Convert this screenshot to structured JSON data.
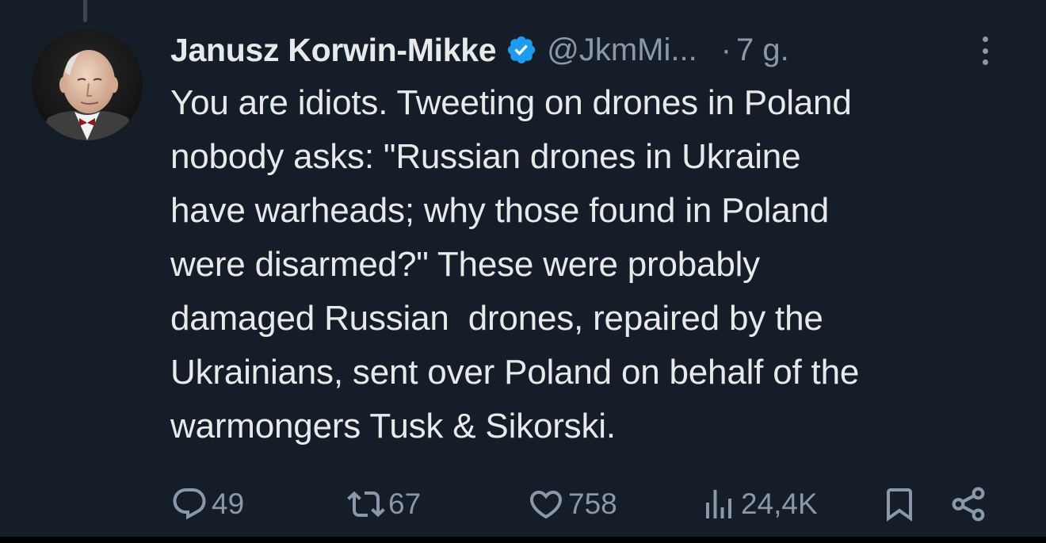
{
  "author": {
    "display_name": "Janusz Korwin-Mikke",
    "handle": "@JkmMi...",
    "verified": true,
    "separator": "·",
    "timestamp": "7 g."
  },
  "tweet": {
    "text": "You are idiots. Tweeting on drones in Poland\nnobody asks: \"Russian drones in Ukraine\nhave warheads; why those found in Poland\nwere disarmed?\" These were probably\ndamaged Russian  drones, repaired by the\nUkrainians, sent over Poland on behalf of the\nwarmongers Tusk & Sikorski."
  },
  "actions": {
    "replies": "49",
    "retweets": "67",
    "likes": "758",
    "views": "24,4K"
  },
  "icons": {
    "reply": "reply-icon",
    "retweet": "retweet-icon",
    "like": "heart-icon",
    "views": "views-icon",
    "bookmark": "bookmark-icon",
    "share": "share-icon",
    "more": "more-options-icon",
    "verified": "verified-badge-icon"
  },
  "colors": {
    "background": "#151d28",
    "text_primary": "#e7e9ea",
    "text_secondary": "#8b98a5",
    "verified_blue": "#1d9bf0"
  }
}
